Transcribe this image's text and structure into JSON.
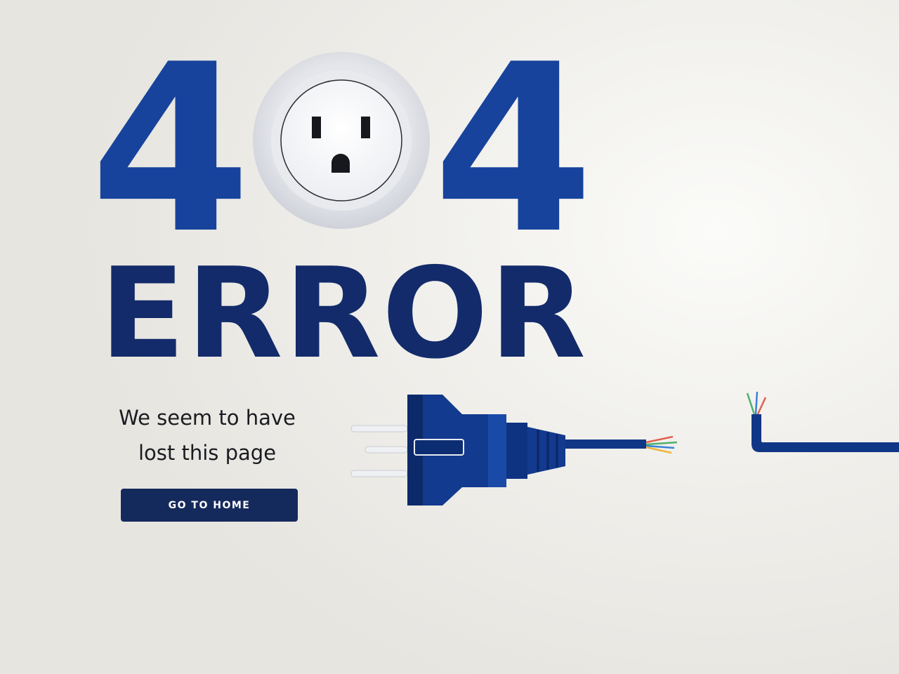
{
  "hero": {
    "digit_left": "4",
    "digit_right": "4",
    "outlet_icon": "power-outlet-icon",
    "error_word": "ERROR"
  },
  "message": {
    "line1": "We seem to have",
    "line2": "lost this page"
  },
  "actions": {
    "home_label": "GO TO HOME"
  },
  "illustration": {
    "plug_icon": "unplugged-plug-icon",
    "cable_icon": "cut-cable-icon"
  },
  "colors": {
    "digits": "#17439c",
    "error_word": "#132b6a",
    "button": "#152a5c",
    "plug": "#123a8e",
    "background": "#f1f0ec"
  }
}
